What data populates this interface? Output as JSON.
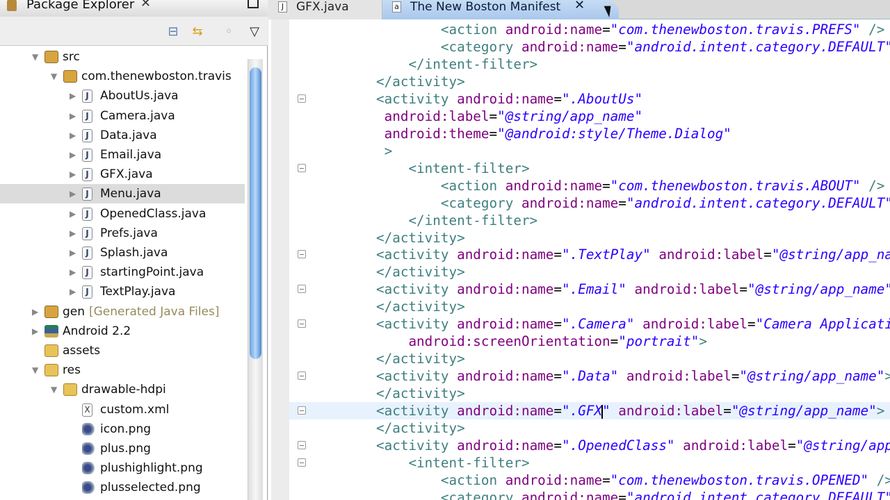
{
  "package_explorer": {
    "title": "Package Explorer",
    "tree": [
      {
        "label": "src",
        "icon": "source-folder-icon",
        "kind": "pkg",
        "depth": 0,
        "expanded": true
      },
      {
        "label": "com.thenewboston.travis",
        "icon": "package-icon",
        "kind": "pkg",
        "depth": 1,
        "expanded": true
      },
      {
        "label": "AboutUs.java",
        "icon": "java-file-icon",
        "kind": "java",
        "depth": 2,
        "expanded": false
      },
      {
        "label": "Camera.java",
        "icon": "java-file-icon",
        "kind": "java",
        "depth": 2,
        "expanded": false
      },
      {
        "label": "Data.java",
        "icon": "java-file-icon",
        "kind": "java",
        "depth": 2,
        "expanded": false
      },
      {
        "label": "Email.java",
        "icon": "java-file-icon",
        "kind": "java",
        "depth": 2,
        "expanded": false
      },
      {
        "label": "GFX.java",
        "icon": "java-file-icon",
        "kind": "java",
        "depth": 2,
        "expanded": false
      },
      {
        "label": "Menu.java",
        "icon": "java-file-icon",
        "kind": "java",
        "depth": 2,
        "expanded": false,
        "selected": true
      },
      {
        "label": "OpenedClass.java",
        "icon": "java-file-icon",
        "kind": "java",
        "depth": 2,
        "expanded": false
      },
      {
        "label": "Prefs.java",
        "icon": "java-file-icon",
        "kind": "java",
        "depth": 2,
        "expanded": false
      },
      {
        "label": "Splash.java",
        "icon": "java-file-icon",
        "kind": "java",
        "depth": 2,
        "expanded": false
      },
      {
        "label": "startingPoint.java",
        "icon": "java-file-icon",
        "kind": "java",
        "depth": 2,
        "expanded": false
      },
      {
        "label": "TextPlay.java",
        "icon": "java-file-icon",
        "kind": "java",
        "depth": 2,
        "expanded": false
      },
      {
        "label": "gen",
        "suffix": "[Generated Java Files]",
        "icon": "source-folder-icon",
        "kind": "pkg",
        "depth": 0,
        "expanded": false
      },
      {
        "label": "Android 2.2",
        "icon": "library-icon",
        "kind": "lib",
        "depth": 0,
        "expanded": false
      },
      {
        "label": "assets",
        "icon": "folder-icon",
        "kind": "folder",
        "depth": 0
      },
      {
        "label": "res",
        "icon": "folder-icon",
        "kind": "folder",
        "depth": 0,
        "expanded": true
      },
      {
        "label": "drawable-hdpi",
        "icon": "folder-icon",
        "kind": "folder",
        "depth": 1,
        "expanded": true
      },
      {
        "label": "custom.xml",
        "icon": "xml-file-icon",
        "kind": "xml",
        "depth": 2
      },
      {
        "label": "icon.png",
        "icon": "image-file-icon",
        "kind": "png",
        "depth": 2
      },
      {
        "label": "plus.png",
        "icon": "image-file-icon",
        "kind": "png",
        "depth": 2
      },
      {
        "label": "plushighlight.png",
        "icon": "image-file-icon",
        "kind": "png",
        "depth": 2
      },
      {
        "label": "plusselected.png",
        "icon": "image-file-icon",
        "kind": "png",
        "depth": 2
      }
    ]
  },
  "editor": {
    "tabs": [
      {
        "label": "GFX.java",
        "active": false
      },
      {
        "label": "The New Boston Manifest",
        "active": true
      }
    ],
    "lines": [
      {
        "indent": 8,
        "t": [
          [
            "tag",
            "<action "
          ],
          [
            "attr",
            "android:name"
          ],
          [
            "txt",
            "="
          ],
          [
            "val",
            "\"com.thenewboston.travis.PREFS\""
          ],
          [
            "tag",
            " />"
          ]
        ]
      },
      {
        "indent": 8,
        "t": [
          [
            "tag",
            "<category "
          ],
          [
            "attr",
            "android:name"
          ],
          [
            "txt",
            "="
          ],
          [
            "val",
            "\"android.intent.category.DEFAULT\""
          ],
          [
            "tag",
            " />"
          ]
        ]
      },
      {
        "indent": 4,
        "t": [
          [
            "tag",
            "</intent-filter>"
          ]
        ]
      },
      {
        "indent": 0,
        "t": [
          [
            "tag",
            "</activity>"
          ]
        ]
      },
      {
        "indent": 0,
        "fold": true,
        "t": [
          [
            "tag",
            "<activity "
          ],
          [
            "attr",
            "android:name"
          ],
          [
            "txt",
            "="
          ],
          [
            "val",
            "\".AboutUs\""
          ]
        ]
      },
      {
        "indent": 1,
        "t": [
          [
            "attr",
            "android:label"
          ],
          [
            "txt",
            "="
          ],
          [
            "val",
            "\"@string/app_name\""
          ]
        ]
      },
      {
        "indent": 1,
        "t": [
          [
            "attr",
            "android:theme"
          ],
          [
            "txt",
            "="
          ],
          [
            "val",
            "\"@android:style/Theme.Dialog\""
          ]
        ]
      },
      {
        "indent": 1,
        "t": [
          [
            "tag",
            ">"
          ]
        ]
      },
      {
        "indent": 4,
        "fold": true,
        "t": [
          [
            "tag",
            "<intent-filter>"
          ]
        ]
      },
      {
        "indent": 8,
        "t": [
          [
            "tag",
            "<action "
          ],
          [
            "attr",
            "android:name"
          ],
          [
            "txt",
            "="
          ],
          [
            "val",
            "\"com.thenewboston.travis.ABOUT\""
          ],
          [
            "tag",
            " />"
          ]
        ]
      },
      {
        "indent": 8,
        "t": [
          [
            "tag",
            "<category "
          ],
          [
            "attr",
            "android:name"
          ],
          [
            "txt",
            "="
          ],
          [
            "val",
            "\"android.intent.category.DEFAULT\""
          ],
          [
            "tag",
            " />"
          ]
        ]
      },
      {
        "indent": 4,
        "t": [
          [
            "tag",
            "</intent-filter>"
          ]
        ]
      },
      {
        "indent": 0,
        "t": [
          [
            "tag",
            "</activity>"
          ]
        ]
      },
      {
        "indent": 0,
        "fold": true,
        "t": [
          [
            "tag",
            "<activity "
          ],
          [
            "attr",
            "android:name"
          ],
          [
            "txt",
            "="
          ],
          [
            "val",
            "\".TextPlay\""
          ],
          [
            "txt",
            " "
          ],
          [
            "attr",
            "android:label"
          ],
          [
            "txt",
            "="
          ],
          [
            "val",
            "\"@string/app_name\""
          ],
          [
            "tag",
            ">"
          ]
        ]
      },
      {
        "indent": 0,
        "t": [
          [
            "tag",
            "</activity>"
          ]
        ]
      },
      {
        "indent": 0,
        "fold": true,
        "t": [
          [
            "tag",
            "<activity "
          ],
          [
            "attr",
            "android:name"
          ],
          [
            "txt",
            "="
          ],
          [
            "val",
            "\".Email\""
          ],
          [
            "txt",
            " "
          ],
          [
            "attr",
            "android:label"
          ],
          [
            "txt",
            "="
          ],
          [
            "val",
            "\"@string/app_name\""
          ],
          [
            "tag",
            ">"
          ]
        ]
      },
      {
        "indent": 0,
        "t": [
          [
            "tag",
            "</activity>"
          ]
        ]
      },
      {
        "indent": 0,
        "fold": true,
        "t": [
          [
            "tag",
            "<activity "
          ],
          [
            "attr",
            "android:name"
          ],
          [
            "txt",
            "="
          ],
          [
            "val",
            "\".Camera\""
          ],
          [
            "txt",
            " "
          ],
          [
            "attr",
            "android:label"
          ],
          [
            "txt",
            "="
          ],
          [
            "val",
            "\"Camera Application\""
          ]
        ]
      },
      {
        "indent": 4,
        "t": [
          [
            "attr",
            "android:screenOrientation"
          ],
          [
            "txt",
            "="
          ],
          [
            "val",
            "\"portrait\""
          ],
          [
            "tag",
            ">"
          ]
        ]
      },
      {
        "indent": 0,
        "t": [
          [
            "tag",
            "</activity>"
          ]
        ]
      },
      {
        "indent": 0,
        "fold": true,
        "t": [
          [
            "tag",
            "<activity "
          ],
          [
            "attr",
            "android:name"
          ],
          [
            "txt",
            "="
          ],
          [
            "val",
            "\".Data\""
          ],
          [
            "txt",
            " "
          ],
          [
            "attr",
            "android:label"
          ],
          [
            "txt",
            "="
          ],
          [
            "val",
            "\"@string/app_name\""
          ],
          [
            "tag",
            ">"
          ]
        ]
      },
      {
        "indent": 0,
        "t": [
          [
            "tag",
            "</activity>"
          ]
        ]
      },
      {
        "indent": 0,
        "fold": true,
        "current": true,
        "t": [
          [
            "tag",
            "<activity "
          ],
          [
            "attr",
            "android:name"
          ],
          [
            "txt",
            "="
          ],
          [
            "val",
            "\".GFX"
          ],
          [
            "caret",
            ""
          ],
          [
            "val",
            "\""
          ],
          [
            "txt",
            " "
          ],
          [
            "attr",
            "android:label"
          ],
          [
            "txt",
            "="
          ],
          [
            "val",
            "\"@string/app_name\""
          ],
          [
            "tag",
            ">"
          ]
        ]
      },
      {
        "indent": 0,
        "t": [
          [
            "tag",
            "</activity>"
          ]
        ]
      },
      {
        "indent": 0,
        "fold": true,
        "t": [
          [
            "tag",
            "<activity "
          ],
          [
            "attr",
            "android:name"
          ],
          [
            "txt",
            "="
          ],
          [
            "val",
            "\".OpenedClass\""
          ],
          [
            "txt",
            " "
          ],
          [
            "attr",
            "android:label"
          ],
          [
            "txt",
            "="
          ],
          [
            "val",
            "\"@string/app_name\""
          ],
          [
            "tag",
            ">"
          ]
        ]
      },
      {
        "indent": 4,
        "fold": true,
        "t": [
          [
            "tag",
            "<intent-filter>"
          ]
        ]
      },
      {
        "indent": 8,
        "t": [
          [
            "tag",
            "<action "
          ],
          [
            "attr",
            "android:name"
          ],
          [
            "txt",
            "="
          ],
          [
            "val",
            "\"com.thenewboston.travis.OPENED\""
          ],
          [
            "tag",
            " />"
          ]
        ]
      },
      {
        "indent": 8,
        "t": [
          [
            "tag",
            "<category "
          ],
          [
            "attr",
            "android:name"
          ],
          [
            "txt",
            "="
          ],
          [
            "val",
            "\"android.intent.category.DEFAULT\""
          ],
          [
            "tag",
            " />"
          ]
        ]
      }
    ]
  },
  "colors": {
    "tag": "#3f7f7f",
    "attr": "#7f007f",
    "value": "#2a00ff",
    "selection": "#dcdcdc",
    "active_tab": "#b8d2f0"
  }
}
